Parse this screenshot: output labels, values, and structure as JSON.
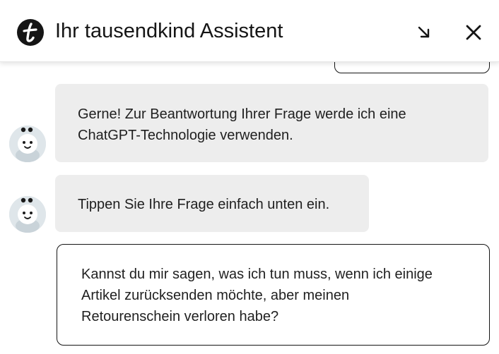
{
  "header": {
    "title": "Ihr tausendkind Assistent",
    "minimize_icon": "arrow-down-right-icon",
    "close_icon": "close-icon"
  },
  "messages": [
    {
      "from": "bot",
      "text_line1": "Gerne! Zur Beantwortung Ihrer Frage werde ich eine",
      "text_line2": "ChatGPT-Technologie verwenden."
    },
    {
      "from": "bot",
      "text_line1": "Tippen Sie Ihre Frage einfach unten ein."
    },
    {
      "from": "user",
      "text_line1": "Kannst du mir sagen, was ich tun muss, wenn ich einige",
      "text_line2": "Artikel zurücksenden möchte, aber meinen",
      "text_line3": "Retourenschein verloren habe?"
    }
  ],
  "colors": {
    "bot_bubble": "#ededed",
    "user_border": "#151515",
    "header_text": "#151515"
  }
}
